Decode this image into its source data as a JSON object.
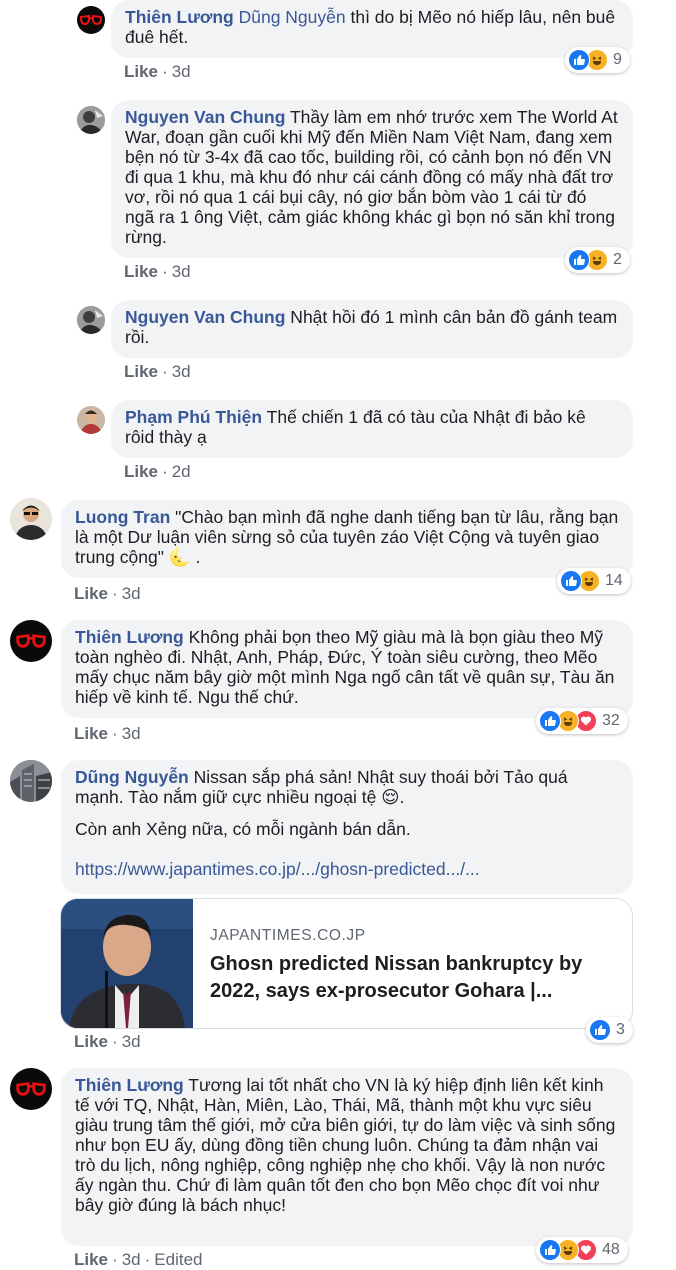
{
  "ui_text": {
    "like_label": "Like",
    "dot": "·"
  },
  "comments": [
    {
      "author": "Thiên Lương",
      "mention": "Dũng Nguyễn",
      "text": " thì do bị Mẽo nó hiếp lâu, nên buê đuê hết.",
      "time": "3d",
      "reactions": [
        "like",
        "haha"
      ],
      "reaction_count": "9"
    },
    {
      "author": "Nguyen Van Chung",
      "text": " Thầy làm em nhớ trước xem The World At War, đoạn gần cuối khi Mỹ đến Miền Nam Việt Nam, đang xem bện nó từ 3-4x đã cao tốc, building rồi, có cảnh bọn nó đến VN đi qua 1 khu, mà khu đó như cái cánh đồng có mấy nhà đất trơ vơ, rồi nó qua 1 cái bụi cây, nó giơ bắn bòm vào 1 cái từ đó ngã ra 1 ông Việt, cảm giác không khác gì bọn nó săn khỉ trong rừng.",
      "time": "3d",
      "reactions": [
        "like",
        "haha"
      ],
      "reaction_count": "2"
    },
    {
      "author": "Nguyen Van Chung",
      "text": " Nhật hồi đó 1 mình cân bản đồ gánh team rồi.",
      "time": "3d"
    },
    {
      "author": "Phạm Phú Thiện",
      "text": " Thế chiến 1 đã có tàu của Nhật đi bảo kê rôid thày ạ",
      "time": "2d"
    },
    {
      "author": "Luong Tran",
      "text": " \"Chào bạn mình đã nghe danh tiếng bạn từ lâu, rằng bạn là một Dư luận viên sừng sỏ của tuyên záo Việt Cộng và tuyên giao trung cộng\" ",
      "emoji": "🌜",
      "text_end": " .",
      "time": "3d",
      "reactions": [
        "like",
        "haha"
      ],
      "reaction_count": "14"
    },
    {
      "author": "Thiên Lương",
      "text": " Không phải bọn theo Mỹ giàu mà là bọn giàu theo Mỹ toàn nghèo đi. Nhật, Anh, Pháp, Đức, Ý toàn siêu cường, theo Mẽo mấy chục năm bây giờ một mình Nga ngố cân tất về quân sự, Tàu ăn hiếp về kinh tế. Ngu thế chứ.",
      "time": "3d",
      "reactions": [
        "like",
        "haha",
        "love"
      ],
      "reaction_count": "32"
    },
    {
      "author": "Dũng Nguyễn",
      "text": " Nissan sắp phá sản! Nhật suy thoái bởi Tảo quá mạnh. Tào nắm giữ cực nhiều ngoại tệ ",
      "emoji": "😌",
      "text_end": ".",
      "paragraph2": "Còn anh Xẻng nữa, có mỗi ngành bán dẫn.",
      "link": "https://www.japantimes.co.jp/.../ghosn-predicted.../...",
      "preview": {
        "domain": "JAPANTIMES.CO.JP",
        "title": "Ghosn predicted Nissan bankruptcy by 2022, says ex-prosecutor Gohara |..."
      },
      "time": "3d",
      "reactions": [
        "like"
      ],
      "reaction_count": "3"
    },
    {
      "author": "Thiên Lương",
      "text": " Tương lai tốt nhất cho VN là ký hiệp định liên kết kinh tế với TQ, Nhật, Hàn, Miên, Lào, Thái, Mã, thành một khu vực siêu giàu trung tâm thế giới, mở cửa biên giới, tự do làm việc và sinh sống như bọn EU ấy, dùng đồng tiền chung luôn. Chúng ta đảm nhận vai trò du lịch, nông nghiệp, công nghiệp nhẹ cho khối. Vậy là non nước ấy ngàn thu. Chứ đi làm quân tốt đen cho bọn Mẽo chọc đít voi như bây giờ đúng là bách nhục!",
      "time": "3d",
      "edited": "Edited",
      "reactions": [
        "like",
        "haha",
        "love"
      ],
      "reaction_count": "48"
    }
  ],
  "colors": {
    "bubble": "#f2f3f5",
    "name": "#385898",
    "meta": "#606770",
    "like_reaction": "#1877f2",
    "haha_reaction": "#f7b125",
    "love_reaction": "#f33e58"
  }
}
